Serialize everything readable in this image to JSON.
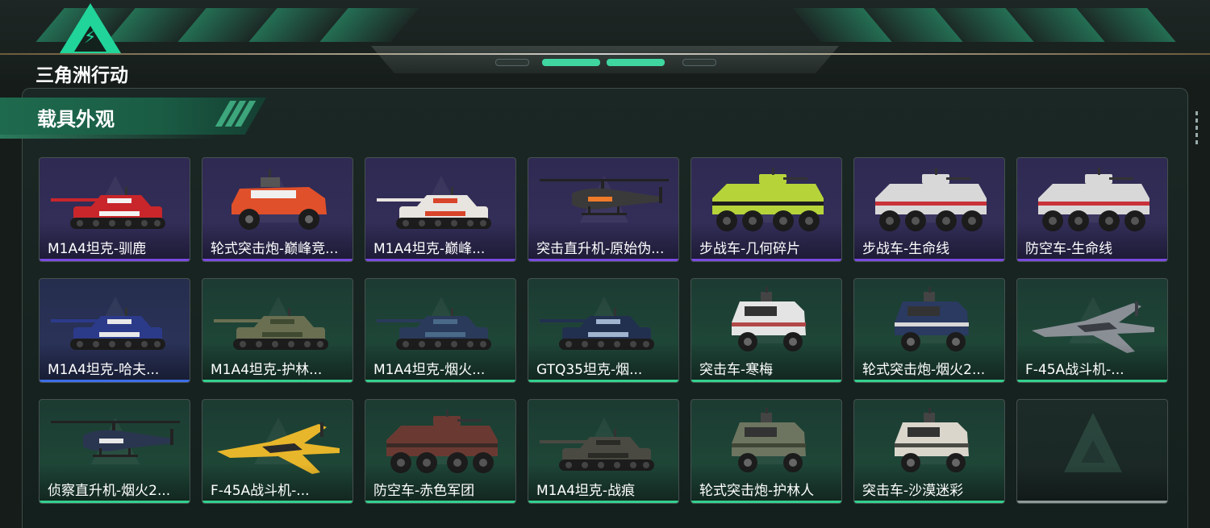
{
  "header": {
    "logo_text": "三角洲行动"
  },
  "panel": {
    "title": "载具外观"
  },
  "colors": {
    "accent": "#21d49a",
    "rarity_purple": "#7a4ae0",
    "rarity_blue": "#3d6ee6",
    "rarity_green": "#33d08e"
  },
  "cards": [
    {
      "name": "M1A4坦克-驯鹿",
      "rarity": "purple",
      "kind": "tank",
      "body": "#c8262b",
      "accent": "#f3f3f3"
    },
    {
      "name": "轮式突击炮-巅峰竞...",
      "rarity": "purple",
      "kind": "wheeled",
      "body": "#e0502a",
      "accent": "#f0f0f0"
    },
    {
      "name": "M1A4坦克-巅峰...",
      "rarity": "purple",
      "kind": "tank",
      "body": "#e8e4e0",
      "accent": "#d8452a"
    },
    {
      "name": "突击直升机-原始伪...",
      "rarity": "purple",
      "kind": "heli",
      "body": "#3a3a3a",
      "accent": "#ee7a2a"
    },
    {
      "name": "步战车-几何碎片",
      "rarity": "purple",
      "kind": "apc",
      "body": "#b6d43a",
      "accent": "#1d1d1d"
    },
    {
      "name": "步战车-生命线",
      "rarity": "purple",
      "kind": "apc",
      "body": "#d8d8d8",
      "accent": "#c8333a"
    },
    {
      "name": "防空车-生命线",
      "rarity": "purple",
      "kind": "apc",
      "body": "#d8d8d8",
      "accent": "#c8333a"
    },
    {
      "name": "M1A4坦克-哈夫...",
      "rarity": "blue",
      "kind": "tank",
      "body": "#2c3a8a",
      "accent": "#e8e8e8"
    },
    {
      "name": "M1A4坦克-护林...",
      "rarity": "green",
      "kind": "tank",
      "body": "#6a6f52",
      "accent": "#3f4a30"
    },
    {
      "name": "M1A4坦克-烟火...",
      "rarity": "green",
      "kind": "tank",
      "body": "#2a3a5a",
      "accent": "#4a6a8a"
    },
    {
      "name": "GTQ35坦克-烟...",
      "rarity": "green",
      "kind": "tank",
      "body": "#22304f",
      "accent": "#a0b4d0"
    },
    {
      "name": "突击车-寒梅",
      "rarity": "green",
      "kind": "car",
      "body": "#e4e4e4",
      "accent": "#b24848"
    },
    {
      "name": "轮式突击炮-烟火2...",
      "rarity": "green",
      "kind": "car",
      "body": "#2a3a60",
      "accent": "#d8d8d8"
    },
    {
      "name": "F-45A战斗机-...",
      "rarity": "green",
      "kind": "jet",
      "body": "#8a8f96",
      "accent": "#3a3e44"
    },
    {
      "name": "侦察直升机-烟火2...",
      "rarity": "green",
      "kind": "heli",
      "body": "#2a3550",
      "accent": "#e8e8e8"
    },
    {
      "name": "F-45A战斗机-...",
      "rarity": "green",
      "kind": "jet",
      "body": "#e8b62a",
      "accent": "#2a2a2a"
    },
    {
      "name": "防空车-赤色军团",
      "rarity": "green",
      "kind": "apc",
      "body": "#6a3a32",
      "accent": "#3a2a26"
    },
    {
      "name": "M1A4坦克-战痕",
      "rarity": "green",
      "kind": "tank",
      "body": "#4a4a42",
      "accent": "#2a2a26"
    },
    {
      "name": "轮式突击炮-护林人",
      "rarity": "green",
      "kind": "car",
      "body": "#6d7560",
      "accent": "#3f4636"
    },
    {
      "name": "突击车-沙漠迷彩",
      "rarity": "green",
      "kind": "car",
      "body": "#dad6cc",
      "accent": "#4a4a44"
    },
    {
      "name": "",
      "rarity": "empty",
      "kind": "none",
      "body": "",
      "accent": ""
    }
  ]
}
